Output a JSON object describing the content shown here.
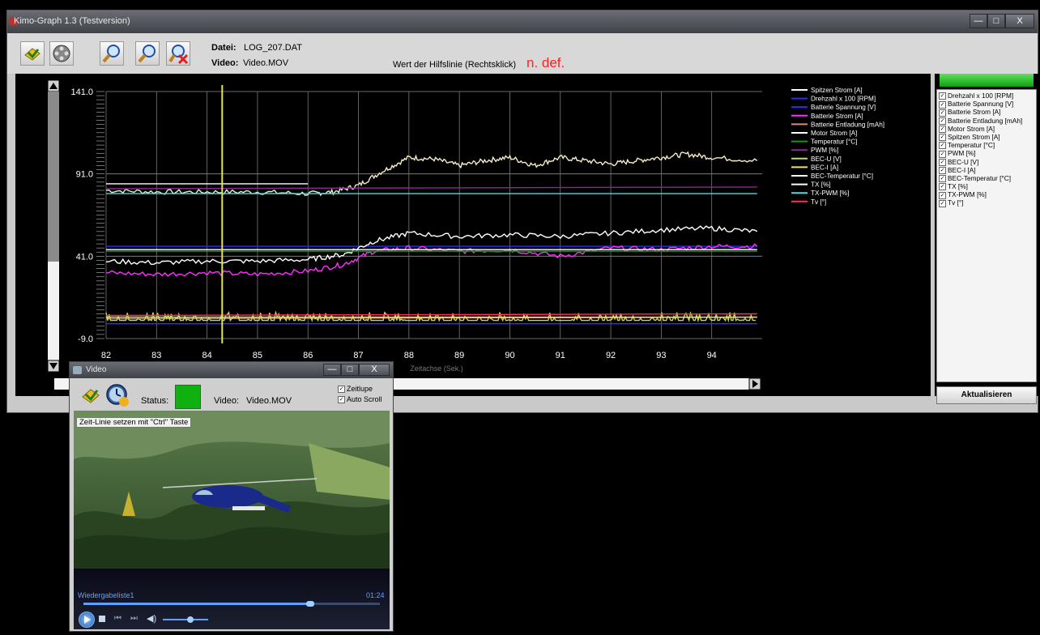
{
  "main": {
    "title": "Kimo-Graph 1.3 (Testversion)",
    "file_label": "Datei:",
    "file_value": "LOG_207.DAT",
    "video_label": "Video:",
    "video_value": "Video.MOV",
    "helpline_label": "Wert der Hilfslinie (Rechtsklick)",
    "helpline_value": "n. def.",
    "update_button": "Aktualisieren",
    "window_buttons": {
      "minimize": "—",
      "maximize": "□",
      "close": "X"
    }
  },
  "chart_data": {
    "type": "line",
    "xlabel": "Zeitachse (Sek.)",
    "xlim": [
      82,
      95
    ],
    "ylim": [
      -9.0,
      141.0
    ],
    "x_ticks": [
      82,
      83,
      84,
      85,
      86,
      87,
      88,
      89,
      90,
      91,
      92,
      93,
      94
    ],
    "y_ticks": [
      141.0,
      91.0,
      41.0,
      -9.0
    ],
    "y_tick_labels": [
      "141.0",
      "91.0",
      "41.0",
      "-9.0"
    ],
    "cursor_x": 84.3,
    "legend": "right",
    "series": [
      {
        "name": "Spitzen Strom [A]",
        "color": "#ffffff",
        "points": [
          [
            82,
            81
          ],
          [
            83,
            80
          ],
          [
            84,
            80
          ],
          [
            85,
            80
          ],
          [
            86,
            79
          ],
          [
            86.5,
            80
          ],
          [
            87,
            84
          ],
          [
            87.5,
            93
          ],
          [
            88,
            101
          ],
          [
            88.5,
            100
          ],
          [
            89,
            96
          ],
          [
            89.5,
            99
          ],
          [
            90,
            101
          ],
          [
            90.5,
            96
          ],
          [
            91,
            101
          ],
          [
            91.5,
            99
          ],
          [
            92,
            97
          ],
          [
            92.5,
            99
          ],
          [
            93,
            101
          ],
          [
            93.5,
            103
          ],
          [
            94,
            101
          ],
          [
            94.9,
            99
          ]
        ],
        "noise": true,
        "stroke": "#f4ecc8"
      },
      {
        "name": "Drehzahl x 100 [RPM]",
        "color": "#2b2bff",
        "points": [
          [
            82,
            47
          ],
          [
            94.9,
            47
          ]
        ]
      },
      {
        "name": "Batterie Spannung [V]",
        "color": "#3030ff",
        "points": [
          [
            82,
            0
          ],
          [
            94.9,
            0
          ]
        ]
      },
      {
        "name": "Batterie Strom [A]",
        "color": "#ff30ff",
        "points": [
          [
            82,
            31
          ],
          [
            83,
            30
          ],
          [
            84,
            31
          ],
          [
            85,
            30
          ],
          [
            86,
            32
          ],
          [
            86.7,
            36
          ],
          [
            87.3,
            44
          ],
          [
            88,
            46
          ],
          [
            89,
            44
          ],
          [
            90,
            45
          ],
          [
            91,
            41
          ],
          [
            92,
            46
          ],
          [
            93,
            45
          ],
          [
            94,
            47
          ],
          [
            94.9,
            47
          ]
        ],
        "noise": true
      },
      {
        "name": "Batterie Entladung [mAh]",
        "color": "#e08a6a",
        "points": [
          [
            82,
            3
          ],
          [
            94.9,
            4
          ]
        ]
      },
      {
        "name": "Motor Strom [A]",
        "color": "#ffffff",
        "points": [
          [
            82,
            38
          ],
          [
            83,
            37
          ],
          [
            84,
            38
          ],
          [
            85,
            38
          ],
          [
            86,
            39
          ],
          [
            86.7,
            42
          ],
          [
            87.3,
            50
          ],
          [
            88,
            55
          ],
          [
            89,
            53
          ],
          [
            90,
            54
          ],
          [
            91,
            53
          ],
          [
            92,
            55
          ],
          [
            93,
            57
          ],
          [
            94,
            58
          ],
          [
            94.9,
            56
          ]
        ],
        "noise": true
      },
      {
        "name": "Temperatur [°C]",
        "color": "#209020",
        "points": [
          [
            82,
            44
          ],
          [
            94.9,
            44
          ]
        ]
      },
      {
        "name": "PWM [%]",
        "color": "#8a2a8a",
        "points": [
          [
            82,
            82
          ],
          [
            94.9,
            83
          ]
        ]
      },
      {
        "name": "BEC-U [V]",
        "color": "#c8d860",
        "points": [
          [
            82,
            2
          ],
          [
            94.9,
            2
          ]
        ],
        "spiky": true
      },
      {
        "name": "BEC-I [A]",
        "color": "#e8e860",
        "points": [
          [
            82,
            4
          ],
          [
            94.9,
            4
          ]
        ]
      },
      {
        "name": "BEC-Temperatur [°C]",
        "color": "#ffffff",
        "points": [
          [
            82,
            45
          ],
          [
            94.9,
            45
          ]
        ]
      },
      {
        "name": "TX [%]",
        "color": "#ffffff",
        "points": [
          [
            82,
            85
          ],
          [
            86,
            85
          ]
        ]
      },
      {
        "name": "TX-PWM [%]",
        "color": "#40e0e0",
        "points": [
          [
            82,
            79
          ],
          [
            94.9,
            79
          ]
        ]
      },
      {
        "name": "Tv [°]",
        "color": "#ff3050",
        "points": [
          [
            82,
            5
          ],
          [
            94.9,
            6
          ]
        ]
      }
    ]
  },
  "checklist": [
    "Drehzahl x 100 [RPM]",
    "Batterie Spannung [V]",
    "Batterie Strom [A]",
    "Batterie Entladung [mAh]",
    "Motor Strom [A]",
    "Spitzen Strom [A]",
    "Temperatur [°C]",
    "PWM [%]",
    "BEC-U [V]",
    "BEC-I [A]",
    "BEC-Temperatur [°C]",
    "TX [%]",
    "TX-PWM [%]",
    "Tv [°]"
  ],
  "check_mark": "✓",
  "video": {
    "title": "Video",
    "status_label": "Status:",
    "video_label": "Video:",
    "video_value": "Video.MOV",
    "zeitlupe": "Zeitlupe",
    "autoscroll": "Auto Scroll",
    "hint": "Zeit-Linie setzen mit \"Ctrl\" Taste",
    "playlist": "Wiedergabeliste1",
    "time": "01:24",
    "status_color": "#10b010"
  }
}
